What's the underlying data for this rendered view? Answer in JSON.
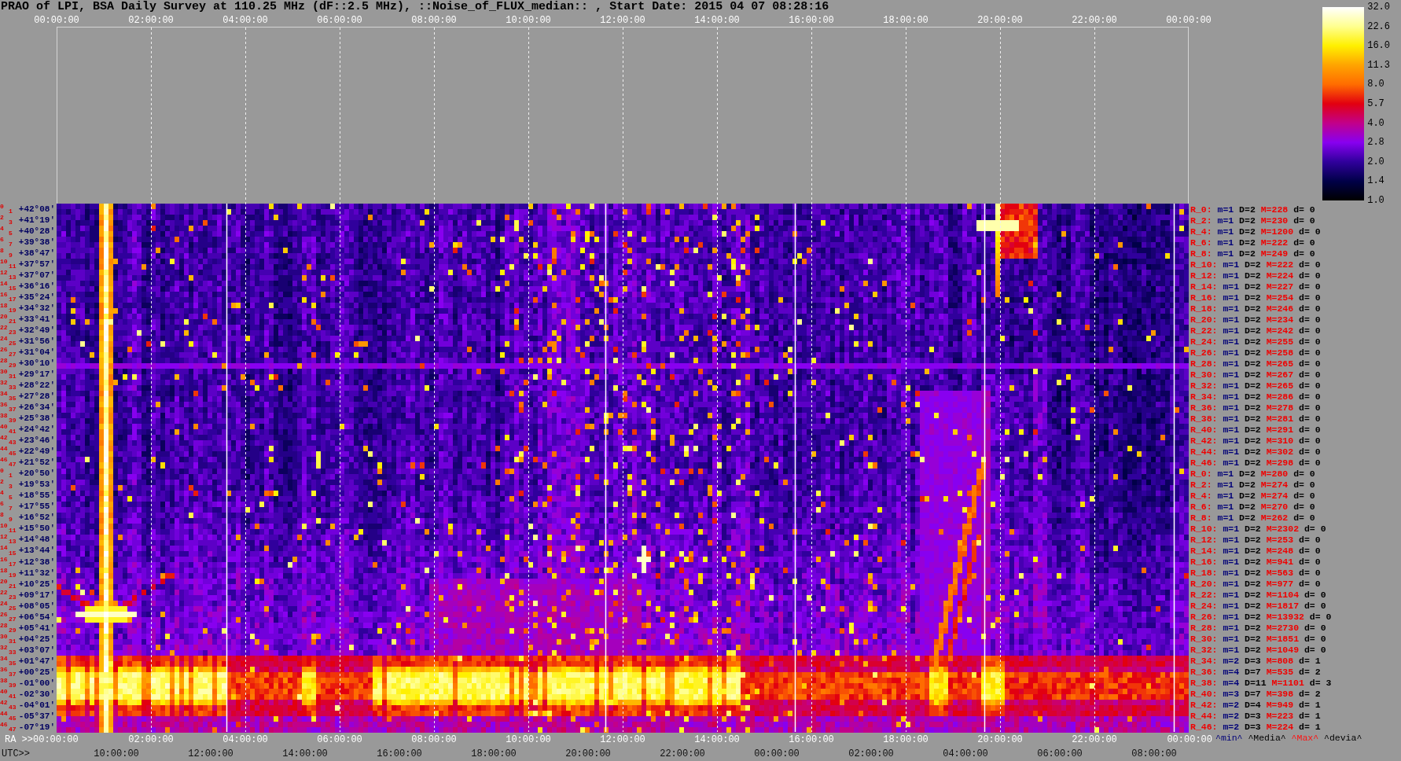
{
  "title": "PRAO of LPI, BSA Daily Survey at 110.25 MHz (dF::2.5 MHz), ::Noise_of_FLUX_median:: , Start Date: 2015 04 07 08:28:16",
  "top_axis": {
    "ticks": [
      "00:00:00",
      "02:00:00",
      "04:00:00",
      "06:00:00",
      "08:00:00",
      "10:00:00",
      "12:00:00",
      "14:00:00",
      "16:00:00",
      "18:00:00",
      "20:00:00",
      "22:00:00",
      "00:00:00"
    ]
  },
  "colorbar": {
    "ticks": [
      "32.0",
      "22.6",
      "16.0",
      "11.3",
      "8.0",
      "5.7",
      "4.0",
      "2.8",
      "2.0",
      "1.4",
      "1.0"
    ]
  },
  "rows": [
    {
      "indices": [
        "0",
        "1"
      ],
      "declination": "+42°08′",
      "beam": "R_0:",
      "min": "m=1",
      "dispersion": "D=2",
      "max": "M=228",
      "deviation": "d= 0"
    },
    {
      "indices": [
        "2",
        "3"
      ],
      "declination": "+41°19′",
      "beam": "R_2:",
      "min": "m=1",
      "dispersion": "D=2",
      "max": "M=230",
      "deviation": "d= 0"
    },
    {
      "indices": [
        "4",
        "5"
      ],
      "declination": "+40°28′",
      "beam": "R_4:",
      "min": "m=1",
      "dispersion": "D=2",
      "max": "M=1200",
      "deviation": "d= 0"
    },
    {
      "indices": [
        "6",
        "7"
      ],
      "declination": "+39°38′",
      "beam": "R_6:",
      "min": "m=1",
      "dispersion": "D=2",
      "max": "M=222",
      "deviation": "d= 0"
    },
    {
      "indices": [
        "8",
        "9"
      ],
      "declination": "+38°47′",
      "beam": "R_8:",
      "min": "m=1",
      "dispersion": "D=2",
      "max": "M=249",
      "deviation": "d= 0"
    },
    {
      "indices": [
        "10",
        "11"
      ],
      "declination": "+37°57′",
      "beam": "R_10:",
      "min": "m=1",
      "dispersion": "D=2",
      "max": "M=222",
      "deviation": "d= 0"
    },
    {
      "indices": [
        "12",
        "13"
      ],
      "declination": "+37°07′",
      "beam": "R_12:",
      "min": "m=1",
      "dispersion": "D=2",
      "max": "M=224",
      "deviation": "d= 0"
    },
    {
      "indices": [
        "14",
        "15"
      ],
      "declination": "+36°16′",
      "beam": "R_14:",
      "min": "m=1",
      "dispersion": "D=2",
      "max": "M=227",
      "deviation": "d= 0"
    },
    {
      "indices": [
        "16",
        "17"
      ],
      "declination": "+35°24′",
      "beam": "R_16:",
      "min": "m=1",
      "dispersion": "D=2",
      "max": "M=254",
      "deviation": "d= 0"
    },
    {
      "indices": [
        "18",
        "19"
      ],
      "declination": "+34°32′",
      "beam": "R_18:",
      "min": "m=1",
      "dispersion": "D=2",
      "max": "M=246",
      "deviation": "d= 0"
    },
    {
      "indices": [
        "20",
        "21"
      ],
      "declination": "+33°41′",
      "beam": "R_20:",
      "min": "m=1",
      "dispersion": "D=2",
      "max": "M=234",
      "deviation": "d= 0"
    },
    {
      "indices": [
        "22",
        "23"
      ],
      "declination": "+32°49′",
      "beam": "R_22:",
      "min": "m=1",
      "dispersion": "D=2",
      "max": "M=242",
      "deviation": "d= 0"
    },
    {
      "indices": [
        "24",
        "25"
      ],
      "declination": "+31°56′",
      "beam": "R_24:",
      "min": "m=1",
      "dispersion": "D=2",
      "max": "M=255",
      "deviation": "d= 0"
    },
    {
      "indices": [
        "26",
        "27"
      ],
      "declination": "+31°04′",
      "beam": "R_26:",
      "min": "m=1",
      "dispersion": "D=2",
      "max": "M=258",
      "deviation": "d= 0"
    },
    {
      "indices": [
        "28",
        "29"
      ],
      "declination": "+30°10′",
      "beam": "R_28:",
      "min": "m=1",
      "dispersion": "D=2",
      "max": "M=265",
      "deviation": "d= 0"
    },
    {
      "indices": [
        "30",
        "31"
      ],
      "declination": "+29°17′",
      "beam": "R_30:",
      "min": "m=1",
      "dispersion": "D=2",
      "max": "M=267",
      "deviation": "d= 0"
    },
    {
      "indices": [
        "32",
        "33"
      ],
      "declination": "+28°22′",
      "beam": "R_32:",
      "min": "m=1",
      "dispersion": "D=2",
      "max": "M=265",
      "deviation": "d= 0"
    },
    {
      "indices": [
        "34",
        "35"
      ],
      "declination": "+27°28′",
      "beam": "R_34:",
      "min": "m=1",
      "dispersion": "D=2",
      "max": "M=286",
      "deviation": "d= 0"
    },
    {
      "indices": [
        "36",
        "37"
      ],
      "declination": "+26°34′",
      "beam": "R_36:",
      "min": "m=1",
      "dispersion": "D=2",
      "max": "M=278",
      "deviation": "d= 0"
    },
    {
      "indices": [
        "38",
        "39"
      ],
      "declination": "+25°38′",
      "beam": "R_38:",
      "min": "m=1",
      "dispersion": "D=2",
      "max": "M=281",
      "deviation": "d= 0"
    },
    {
      "indices": [
        "40",
        "41"
      ],
      "declination": "+24°42′",
      "beam": "R_40:",
      "min": "m=1",
      "dispersion": "D=2",
      "max": "M=291",
      "deviation": "d= 0"
    },
    {
      "indices": [
        "42",
        "43"
      ],
      "declination": "+23°46′",
      "beam": "R_42:",
      "min": "m=1",
      "dispersion": "D=2",
      "max": "M=310",
      "deviation": "d= 0"
    },
    {
      "indices": [
        "44",
        "45"
      ],
      "declination": "+22°49′",
      "beam": "R_44:",
      "min": "m=1",
      "dispersion": "D=2",
      "max": "M=302",
      "deviation": "d= 0"
    },
    {
      "indices": [
        "46",
        "47"
      ],
      "declination": "+21°52′",
      "beam": "R_46:",
      "min": "m=1",
      "dispersion": "D=2",
      "max": "M=298",
      "deviation": "d= 0"
    },
    {
      "indices": [
        "0",
        "1"
      ],
      "declination": "+20°50′",
      "beam": "R_0:",
      "min": "m=1",
      "dispersion": "D=2",
      "max": "M=280",
      "deviation": "d= 0"
    },
    {
      "indices": [
        "2",
        "3"
      ],
      "declination": "+19°53′",
      "beam": "R_2:",
      "min": "m=1",
      "dispersion": "D=2",
      "max": "M=274",
      "deviation": "d= 0"
    },
    {
      "indices": [
        "4",
        "5"
      ],
      "declination": "+18°55′",
      "beam": "R_4:",
      "min": "m=1",
      "dispersion": "D=2",
      "max": "M=274",
      "deviation": "d= 0"
    },
    {
      "indices": [
        "6",
        "7"
      ],
      "declination": "+17°55′",
      "beam": "R_6:",
      "min": "m=1",
      "dispersion": "D=2",
      "max": "M=270",
      "deviation": "d= 0"
    },
    {
      "indices": [
        "8",
        "9"
      ],
      "declination": "+16°52′",
      "beam": "R_8:",
      "min": "m=1",
      "dispersion": "D=2",
      "max": "M=262",
      "deviation": "d= 0"
    },
    {
      "indices": [
        "10",
        "11"
      ],
      "declination": "+15°50′",
      "beam": "R_10:",
      "min": "m=1",
      "dispersion": "D=2",
      "max": "M=2302",
      "deviation": "d= 0"
    },
    {
      "indices": [
        "12",
        "13"
      ],
      "declination": "+14°48′",
      "beam": "R_12:",
      "min": "m=1",
      "dispersion": "D=2",
      "max": "M=253",
      "deviation": "d= 0"
    },
    {
      "indices": [
        "14",
        "15"
      ],
      "declination": "+13°44′",
      "beam": "R_14:",
      "min": "m=1",
      "dispersion": "D=2",
      "max": "M=248",
      "deviation": "d= 0"
    },
    {
      "indices": [
        "16",
        "17"
      ],
      "declination": "+12°38′",
      "beam": "R_16:",
      "min": "m=1",
      "dispersion": "D=2",
      "max": "M=941",
      "deviation": "d= 0"
    },
    {
      "indices": [
        "18",
        "19"
      ],
      "declination": "+11°32′",
      "beam": "R_18:",
      "min": "m=1",
      "dispersion": "D=2",
      "max": "M=563",
      "deviation": "d= 0"
    },
    {
      "indices": [
        "20",
        "21"
      ],
      "declination": "+10°25′",
      "beam": "R_20:",
      "min": "m=1",
      "dispersion": "D=2",
      "max": "M=977",
      "deviation": "d= 0"
    },
    {
      "indices": [
        "22",
        "23"
      ],
      "declination": "+09°17′",
      "beam": "R_22:",
      "min": "m=1",
      "dispersion": "D=2",
      "max": "M=1104",
      "deviation": "d= 0"
    },
    {
      "indices": [
        "24",
        "25"
      ],
      "declination": "+08°05′",
      "beam": "R_24:",
      "min": "m=1",
      "dispersion": "D=2",
      "max": "M=1817",
      "deviation": "d= 0"
    },
    {
      "indices": [
        "26",
        "27"
      ],
      "declination": "+06°54′",
      "beam": "R_26:",
      "min": "m=1",
      "dispersion": "D=2",
      "max": "M=13932",
      "deviation": "d= 0"
    },
    {
      "indices": [
        "28",
        "29"
      ],
      "declination": "+05°41′",
      "beam": "R_28:",
      "min": "m=1",
      "dispersion": "D=2",
      "max": "M=2730",
      "deviation": "d= 0"
    },
    {
      "indices": [
        "30",
        "31"
      ],
      "declination": "+04°25′",
      "beam": "R_30:",
      "min": "m=1",
      "dispersion": "D=2",
      "max": "M=1851",
      "deviation": "d= 0"
    },
    {
      "indices": [
        "32",
        "33"
      ],
      "declination": "+03°07′",
      "beam": "R_32:",
      "min": "m=1",
      "dispersion": "D=2",
      "max": "M=1049",
      "deviation": "d= 0"
    },
    {
      "indices": [
        "34",
        "35"
      ],
      "declination": "+01°47′",
      "beam": "R_34:",
      "min": "m=2",
      "dispersion": "D=3",
      "max": "M=808",
      "deviation": "d= 1"
    },
    {
      "indices": [
        "36",
        "37"
      ],
      "declination": "+00°25′",
      "beam": "R_36:",
      "min": "m=4",
      "dispersion": "D=7",
      "max": "M=535",
      "deviation": "d= 2"
    },
    {
      "indices": [
        "38",
        "39"
      ],
      "declination": "-01°00′",
      "beam": "R_38:",
      "min": "m=4",
      "dispersion": "D=11",
      "max": "M=1101",
      "deviation": "d= 3"
    },
    {
      "indices": [
        "40",
        "41"
      ],
      "declination": "-02°30′",
      "beam": "R_40:",
      "min": "m=3",
      "dispersion": "D=7",
      "max": "M=398",
      "deviation": "d= 2"
    },
    {
      "indices": [
        "42",
        "43"
      ],
      "declination": "-04°01′",
      "beam": "R_42:",
      "min": "m=2",
      "dispersion": "D=4",
      "max": "M=949",
      "deviation": "d= 1"
    },
    {
      "indices": [
        "44",
        "45"
      ],
      "declination": "-05°37′",
      "beam": "R_44:",
      "min": "m=2",
      "dispersion": "D=3",
      "max": "M=223",
      "deviation": "d= 1"
    },
    {
      "indices": [
        "46",
        "47"
      ],
      "declination": "-07°19′",
      "beam": "R_46:",
      "min": "m=2",
      "dispersion": "D=3",
      "max": "M=224",
      "deviation": "d= 1"
    }
  ],
  "ra_axis": {
    "prefix": "RA >>",
    "ticks": [
      "00:00:00",
      "02:00:00",
      "04:00:00",
      "06:00:00",
      "08:00:00",
      "10:00:00",
      "12:00:00",
      "14:00:00",
      "16:00:00",
      "18:00:00",
      "20:00:00",
      "22:00:00",
      "00:00:00"
    ]
  },
  "legend": [
    {
      "kind": "min",
      "label": "^min^"
    },
    {
      "kind": "median",
      "label": "^Media^"
    },
    {
      "kind": "max",
      "label": "^Max^"
    },
    {
      "kind": "deviation",
      "label": "^devia^"
    }
  ],
  "utc_axis": {
    "prefix": "UTC>>",
    "ticks": [
      "10:00:00",
      "12:00:00",
      "14:00:00",
      "16:00:00",
      "18:00:00",
      "20:00:00",
      "22:00:00",
      "00:00:00",
      "02:00:00",
      "04:00:00",
      "06:00:00",
      "08:00:00"
    ]
  }
}
